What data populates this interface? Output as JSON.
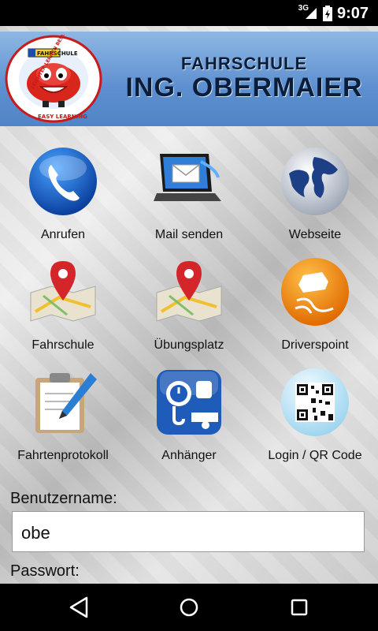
{
  "status_bar": {
    "network": "3G",
    "time": "9:07"
  },
  "header": {
    "title_line1": "FAHRSCHULE",
    "title_line2": "ING. OBERMAIER",
    "logo_text_top": "LEICHTER LERNEN BESSER FAHREN",
    "logo_text_bottom": "EASY LEARNING",
    "logo_badge": "FAHRSCHULE"
  },
  "tiles": [
    {
      "label": "Anrufen",
      "icon": "phone-icon"
    },
    {
      "label": "Mail senden",
      "icon": "mail-laptop-icon"
    },
    {
      "label": "Webseite",
      "icon": "globe-icon"
    },
    {
      "label": "Fahrschule",
      "icon": "map-pin-icon"
    },
    {
      "label": "Übungsplatz",
      "icon": "map-pin-icon"
    },
    {
      "label": "Driverspoint",
      "icon": "skidding-car-icon"
    },
    {
      "label": "Fahrtenprotokoll",
      "icon": "clipboard-pen-icon"
    },
    {
      "label": "Anhänger",
      "icon": "trailer-weight-icon"
    },
    {
      "label": "Login / QR Code",
      "icon": "qr-code-icon"
    }
  ],
  "form": {
    "username_label": "Benutzername:",
    "username_value": "obe",
    "password_label": "Passwort:"
  },
  "nav": {
    "back": "back-icon",
    "home": "home-icon",
    "recents": "recents-icon"
  }
}
